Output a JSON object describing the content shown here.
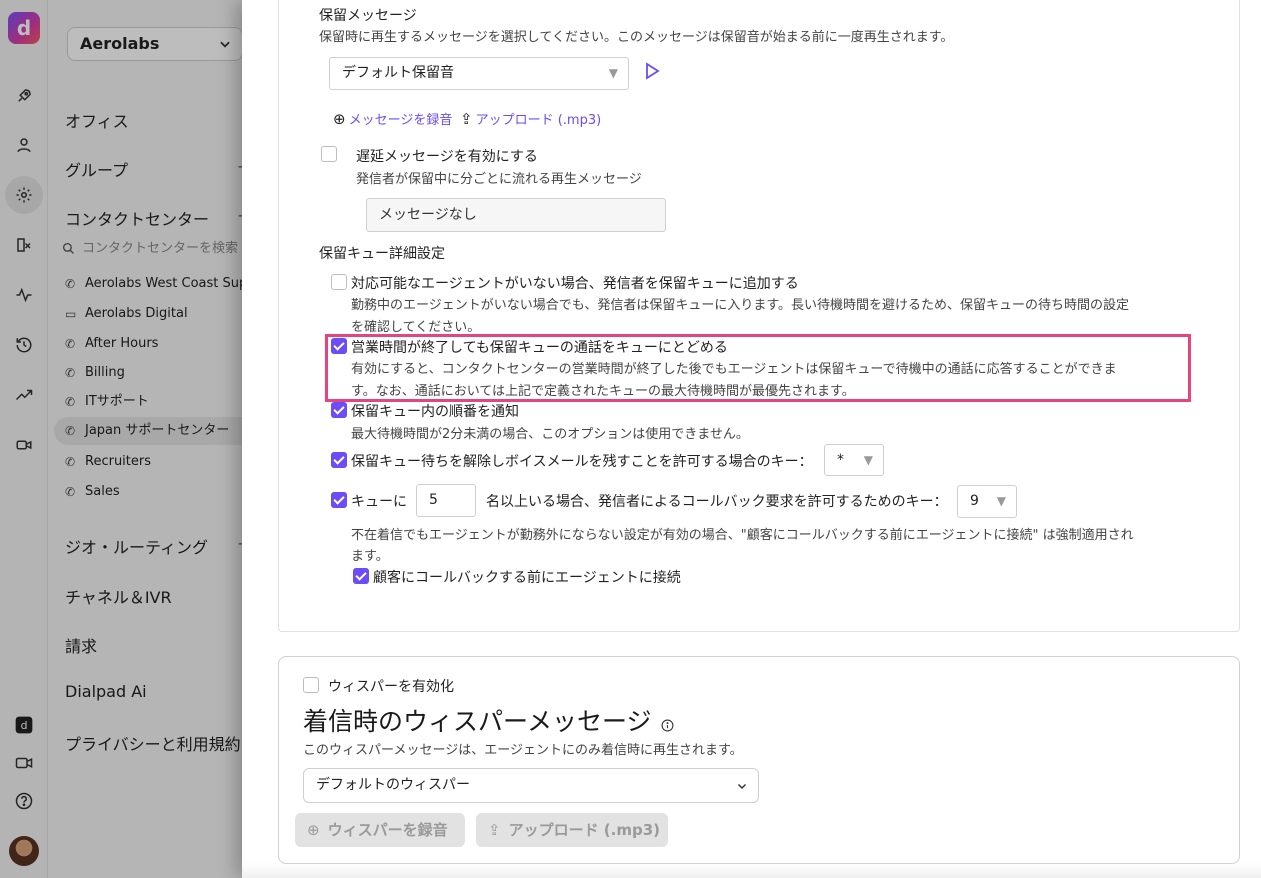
{
  "rail": {
    "logo_text": "d",
    "icons": [
      "rocket-icon",
      "person-icon",
      "gear-icon",
      "routing-icon",
      "activity-icon",
      "history-icon",
      "trending-icon",
      "meeting-icon",
      "ai-app-icon",
      "video-icon",
      "help-icon"
    ]
  },
  "nav": {
    "org_name": "Aerolabs",
    "sections": {
      "office": "オフィス",
      "groups": "グループ",
      "contact_center": "コンタクトセンター",
      "geo_routing": "ジオ・ルーティング",
      "channels_ivr": "チャネル＆IVR",
      "billing": "請求",
      "dialpad_ai": "Dialpad Ai",
      "privacy": "プライバシーと利用規約"
    },
    "search_placeholder": "コンタクトセンターを検索",
    "centers": [
      {
        "label": "Aerolabs West Coast Support",
        "icon": "phone-icon"
      },
      {
        "label": "Aerolabs Digital",
        "icon": "monitor-icon"
      },
      {
        "label": "After Hours",
        "icon": "phone-icon"
      },
      {
        "label": "Billing",
        "icon": "phone-icon"
      },
      {
        "label": "ITサポート",
        "icon": "phone-icon"
      },
      {
        "label": "Japan サポートセンター",
        "icon": "phone-icon"
      },
      {
        "label": "Recruiters",
        "icon": "phone-icon"
      },
      {
        "label": "Sales",
        "icon": "phone-icon"
      }
    ]
  },
  "hold": {
    "title": "保留メッセージ",
    "desc": "保留時に再生するメッセージを選択してください。このメッセージは保留音が始まる前に一度再生されます。",
    "selected": "デフォルト保留音",
    "record_link": "メッセージを録音",
    "upload_link": "アップロード (.mp3)",
    "delay_label": "遅延メッセージを有効にする",
    "delay_desc": "発信者が保留中に分ごとに流れる再生メッセージ",
    "delay_value": "メッセージなし"
  },
  "queue": {
    "title": "保留キュー詳細設定",
    "opt1_label": "対応可能なエージェントがいない場合、発信者を保留キューに追加する",
    "opt1_desc_1": "勤務中のエージェントがいない場合でも、発信者は保留キューに入ります。長い待機時間を避けるため、保留キューの待ち時間の設定",
    "opt1_desc_2": "を確認してください。",
    "opt2_label": "営業時間が終了しても保留キューの通話をキューにとどめる",
    "opt2_desc_1": "有効にすると、コンタクトセンターの営業時間が終了した後でもエージェントは保留キューで待機中の通話に応答することができま",
    "opt2_desc_2": "す。なお、通話においては上記で定義されたキューの最大待機時間が最優先されます。",
    "opt3_label": "保留キュー内の順番を通知",
    "opt3_desc": "最大待機時間が2分未満の場合、このオプションは使用できません。",
    "opt4_label": "保留キュー待ちを解除しボイスメールを残すことを許可する場合のキー：",
    "opt4_key": "*",
    "opt5_prefix": "キューに",
    "opt5_count": "5",
    "opt5_suffix": "名以上いる場合、発信者によるコールバック要求を許可するためのキー：",
    "opt5_key": "9",
    "opt5_note_1": "不在着信でもエージェントが勤務外にならない設定が有効の場合、\"顧客にコールバックする前にエージェントに接続\" は強制適用され",
    "opt5_note_2": "ます。",
    "opt5_sub": "顧客にコールバックする前にエージェントに接続"
  },
  "whisper": {
    "enable_label": "ウィスパーを有効化",
    "title": "着信時のウィスパーメッセージ",
    "desc": "このウィスパーメッセージは、エージェントにのみ着信時に再生されます。",
    "selected": "デフォルトのウィスパー",
    "record_button": "ウィスパーを録音",
    "upload_button": "アップロード (.mp3)"
  },
  "colors": {
    "accent": "#6b4cf6",
    "highlight": "#e8437f"
  }
}
